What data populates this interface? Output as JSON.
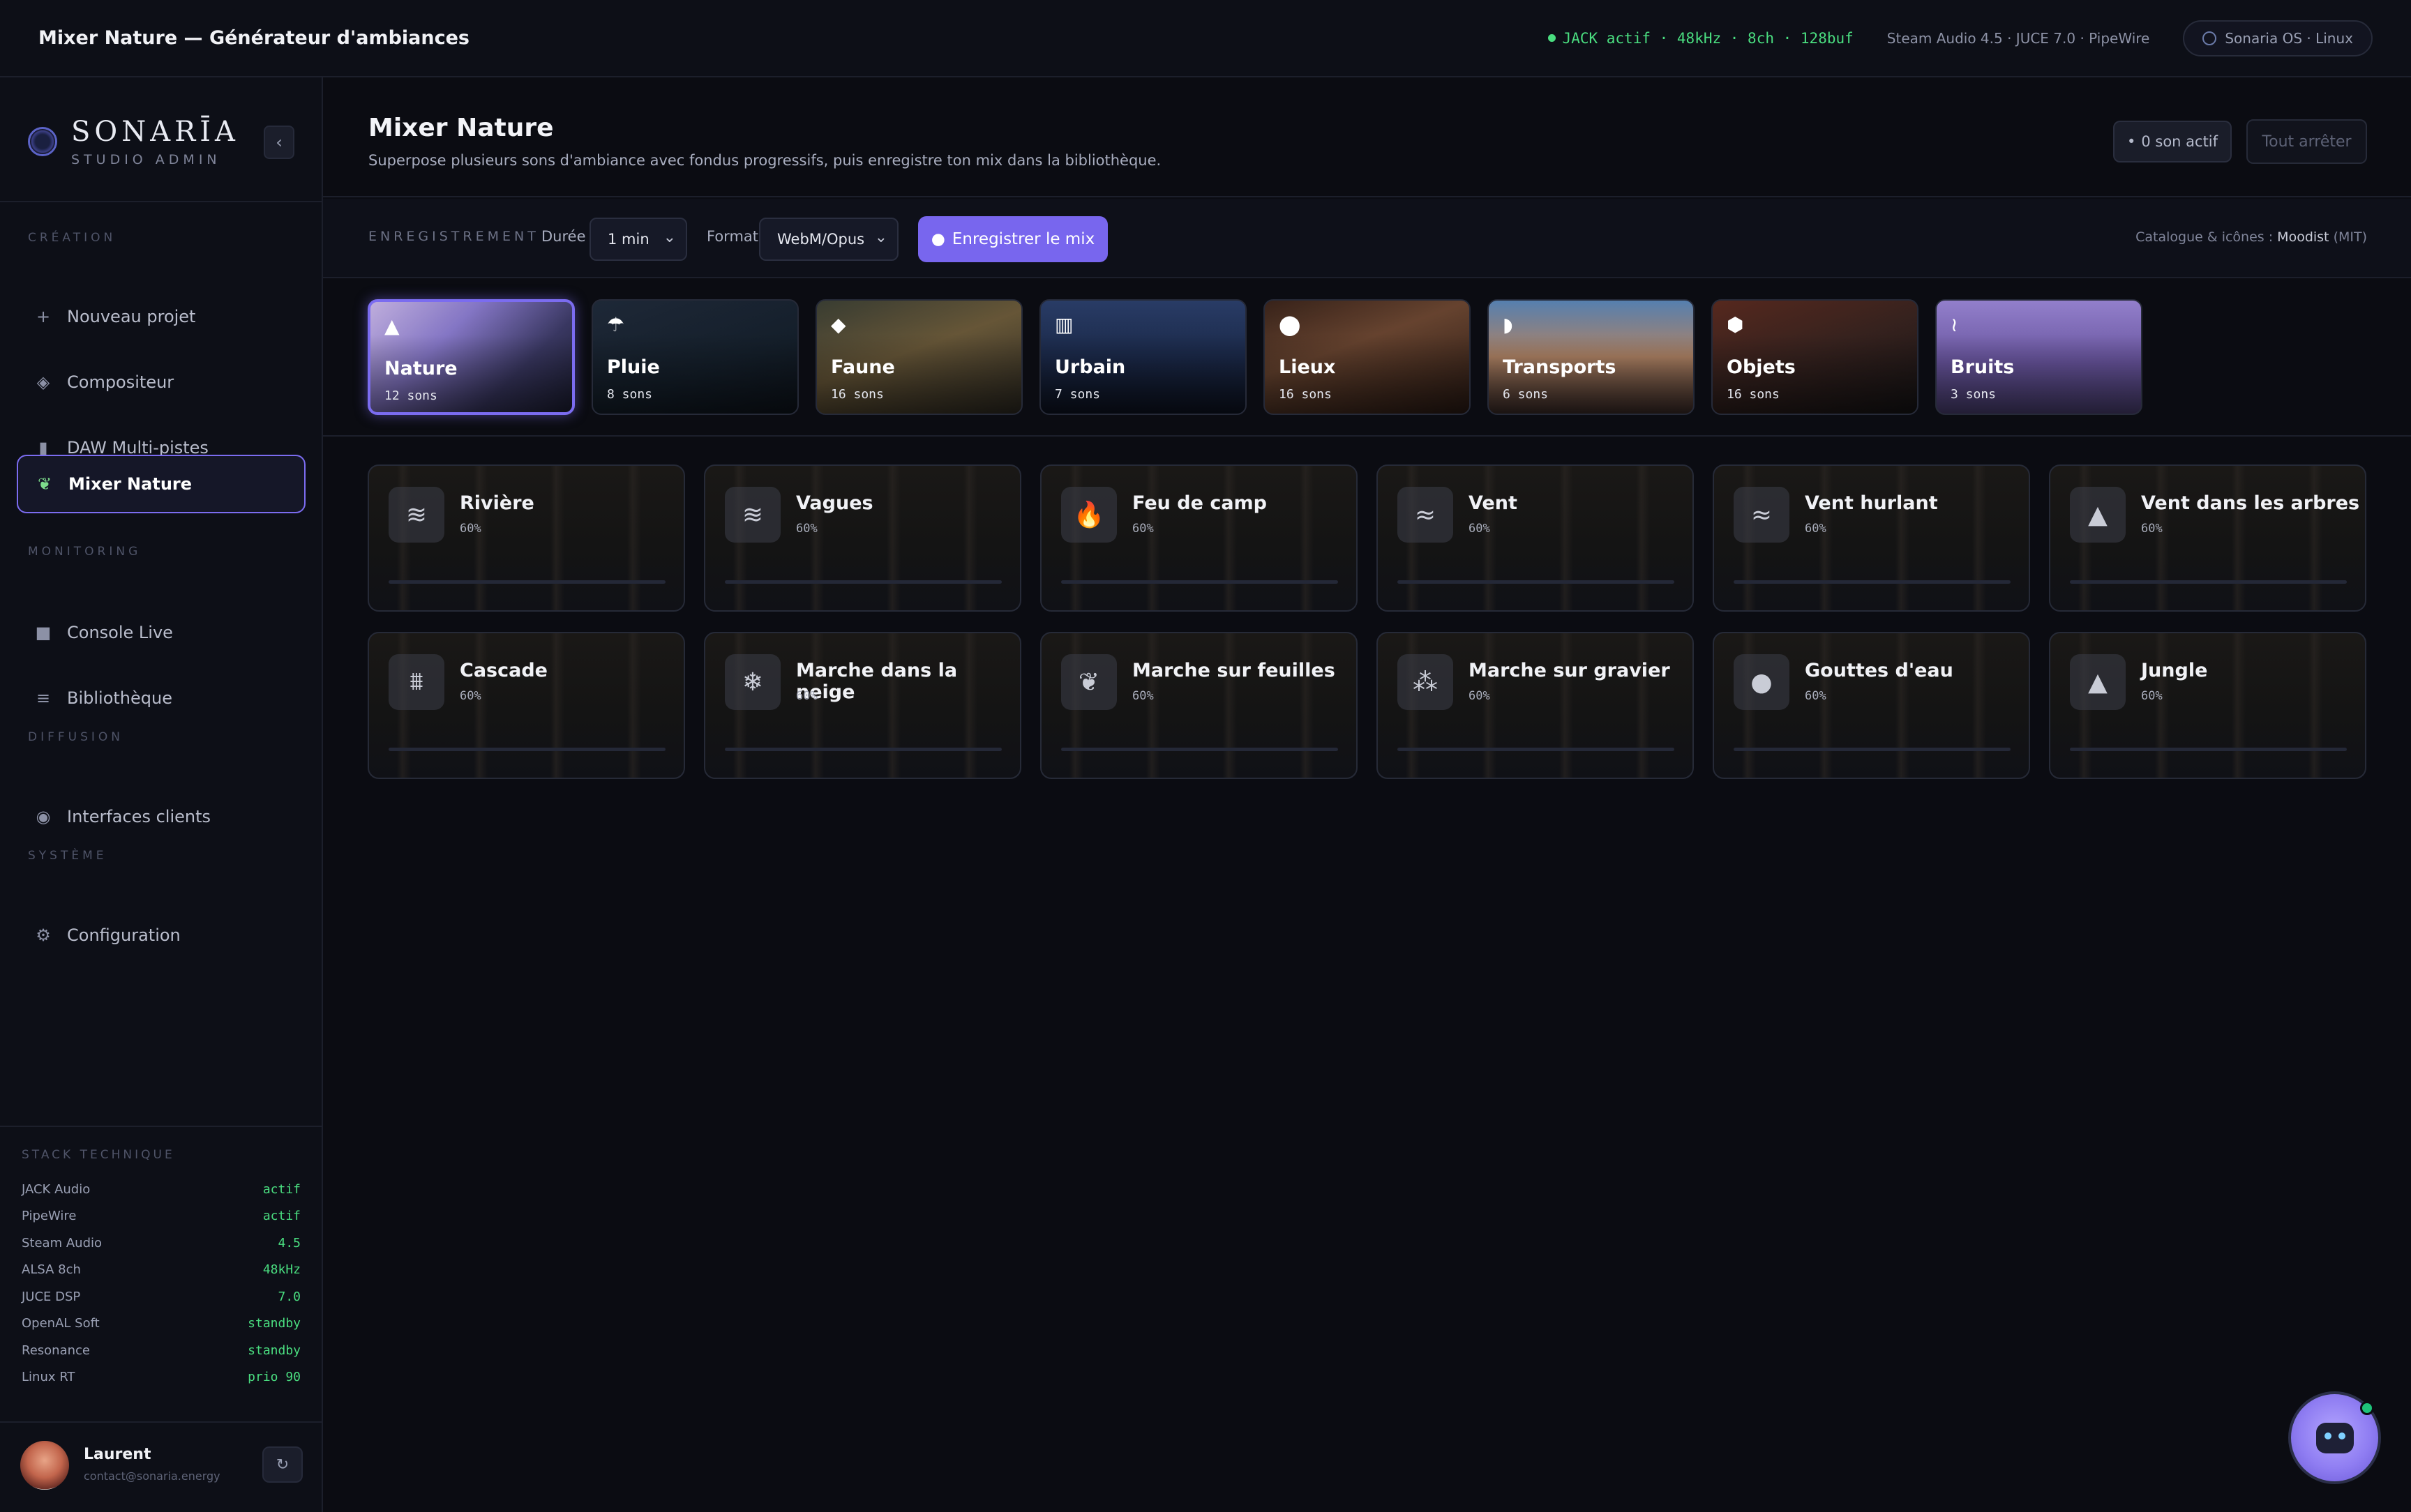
{
  "topbar": {
    "title": "Mixer Nature — Générateur d'ambiances",
    "jack_status": "JACK actif · 48kHz · 8ch · 128buf",
    "stack_info": "Steam Audio 4.5 · JUCE 7.0 · PipeWire",
    "os_label": "Sonaria OS · Linux"
  },
  "brand": {
    "name": "SONARĪA",
    "sub": "STUDIO ADMIN"
  },
  "sidebar": {
    "sections": [
      "CRÉATION",
      "MONITORING",
      "DIFFUSION",
      "SYSTÈME"
    ],
    "items": [
      {
        "label": "Nouveau projet",
        "icon": "plus-icon"
      },
      {
        "label": "Compositeur",
        "icon": "diamond-icon"
      },
      {
        "label": "DAW Multi-pistes",
        "icon": "mixer-icon"
      },
      {
        "label": "Mixer Nature",
        "icon": "leaf-icon",
        "active": true
      },
      {
        "label": "Console Live",
        "icon": "square-icon"
      },
      {
        "label": "Bibliothèque",
        "icon": "list-icon"
      },
      {
        "label": "Interfaces clients",
        "icon": "target-icon"
      },
      {
        "label": "Configuration",
        "icon": "gear-icon"
      }
    ],
    "stack_title": "STACK TECHNIQUE",
    "stack": [
      {
        "name": "JACK Audio",
        "value": "actif"
      },
      {
        "name": "PipeWire",
        "value": "actif"
      },
      {
        "name": "Steam Audio",
        "value": "4.5"
      },
      {
        "name": "ALSA 8ch",
        "value": "48kHz"
      },
      {
        "name": "JUCE DSP",
        "value": "7.0"
      },
      {
        "name": "OpenAL Soft",
        "value": "standby"
      },
      {
        "name": "Resonance",
        "value": "standby"
      },
      {
        "name": "Linux RT",
        "value": "prio 90"
      }
    ],
    "user": {
      "name": "Laurent",
      "email": "contact@sonaria.energy"
    }
  },
  "header": {
    "title": "Mixer Nature",
    "subtitle": "Superpose plusieurs sons d'ambiance avec fondus progressifs, puis enregistre ton mix dans la bibliothèque.",
    "active_count": "0 son actif",
    "stop_all": "Tout arrêter"
  },
  "recording": {
    "label": "ENREGISTREMENT",
    "duration_label": "Durée",
    "duration_value": "1 min",
    "format_label": "Format",
    "format_value": "WebM/Opus",
    "record_button": "Enregistrer le mix",
    "catalog_prefix": "Catalogue & icônes :",
    "catalog_name": "Moodist",
    "catalog_license": "(MIT)"
  },
  "categories": [
    {
      "name": "Nature",
      "count": "12 sons",
      "icon": "tree-icon",
      "active": true,
      "bg": "linear-gradient(135deg,#c9b7e8 0%,#8b7ccf 35%,#3c3a66 70%,#1d1f34 100%)"
    },
    {
      "name": "Pluie",
      "count": "8 sons",
      "icon": "cloud-rain-icon",
      "bg": "linear-gradient(160deg,#1f2a3a 0%,#15202c 60%,#0e141c 100%)"
    },
    {
      "name": "Faune",
      "count": "16 sons",
      "icon": "dog-icon",
      "bg": "linear-gradient(160deg,#3b3f34 0%,#6b5a3a 45%,#2d2a22 100%)"
    },
    {
      "name": "Urbain",
      "count": "7 sons",
      "icon": "city-icon",
      "bg": "linear-gradient(180deg,#2b3f6b 0%,#1c2b4d 50%,#0e1322 100%)"
    },
    {
      "name": "Lieux",
      "count": "16 sons",
      "icon": "map-pin-icon",
      "bg": "linear-gradient(160deg,#3a241b 0%,#6b4631 40%,#2a1a14 100%)"
    },
    {
      "name": "Transports",
      "count": "6 sons",
      "icon": "car-icon",
      "bg": "linear-gradient(180deg,#5a86b8 0%,#b98a6a 50%,#3b2b28 100%)"
    },
    {
      "name": "Objets",
      "count": "16 sons",
      "icon": "robot-icon",
      "bg": "linear-gradient(160deg,#5a2a20 0%,#3a2420 45%,#151416 100%)"
    },
    {
      "name": "Bruits",
      "count": "3 sons",
      "icon": "waveform-icon",
      "bg": "linear-gradient(180deg,#9a86d6 0%,#6f5aa8 55%,#4d4276 100%)"
    }
  ],
  "sounds": [
    {
      "name": "Rivière",
      "volume": "60%",
      "icon": "waves-icon",
      "glyph": "≋"
    },
    {
      "name": "Vagues",
      "volume": "60%",
      "icon": "waves-icon",
      "glyph": "≋"
    },
    {
      "name": "Feu de camp",
      "volume": "60%",
      "icon": "flame-icon",
      "glyph": "🔥"
    },
    {
      "name": "Vent",
      "volume": "60%",
      "icon": "wind-icon",
      "glyph": "≈"
    },
    {
      "name": "Vent hurlant",
      "volume": "60%",
      "icon": "wind-icon",
      "glyph": "≈"
    },
    {
      "name": "Vent dans les arbres",
      "volume": "60%",
      "icon": "tree-icon",
      "glyph": "▲"
    },
    {
      "name": "Cascade",
      "volume": "60%",
      "icon": "waterfall-icon",
      "glyph": "⩩"
    },
    {
      "name": "Marche dans la neige",
      "volume": "60%",
      "icon": "snowflake-icon",
      "glyph": "❄"
    },
    {
      "name": "Marche sur feuilles",
      "volume": "60%",
      "icon": "leaf-icon",
      "glyph": "❦"
    },
    {
      "name": "Marche sur gravier",
      "volume": "60%",
      "icon": "gravel-icon",
      "glyph": "⁂"
    },
    {
      "name": "Gouttes d'eau",
      "volume": "60%",
      "icon": "droplet-icon",
      "glyph": "●"
    },
    {
      "name": "Jungle",
      "volume": "60%",
      "icon": "tree-icon",
      "glyph": "▲"
    }
  ]
}
